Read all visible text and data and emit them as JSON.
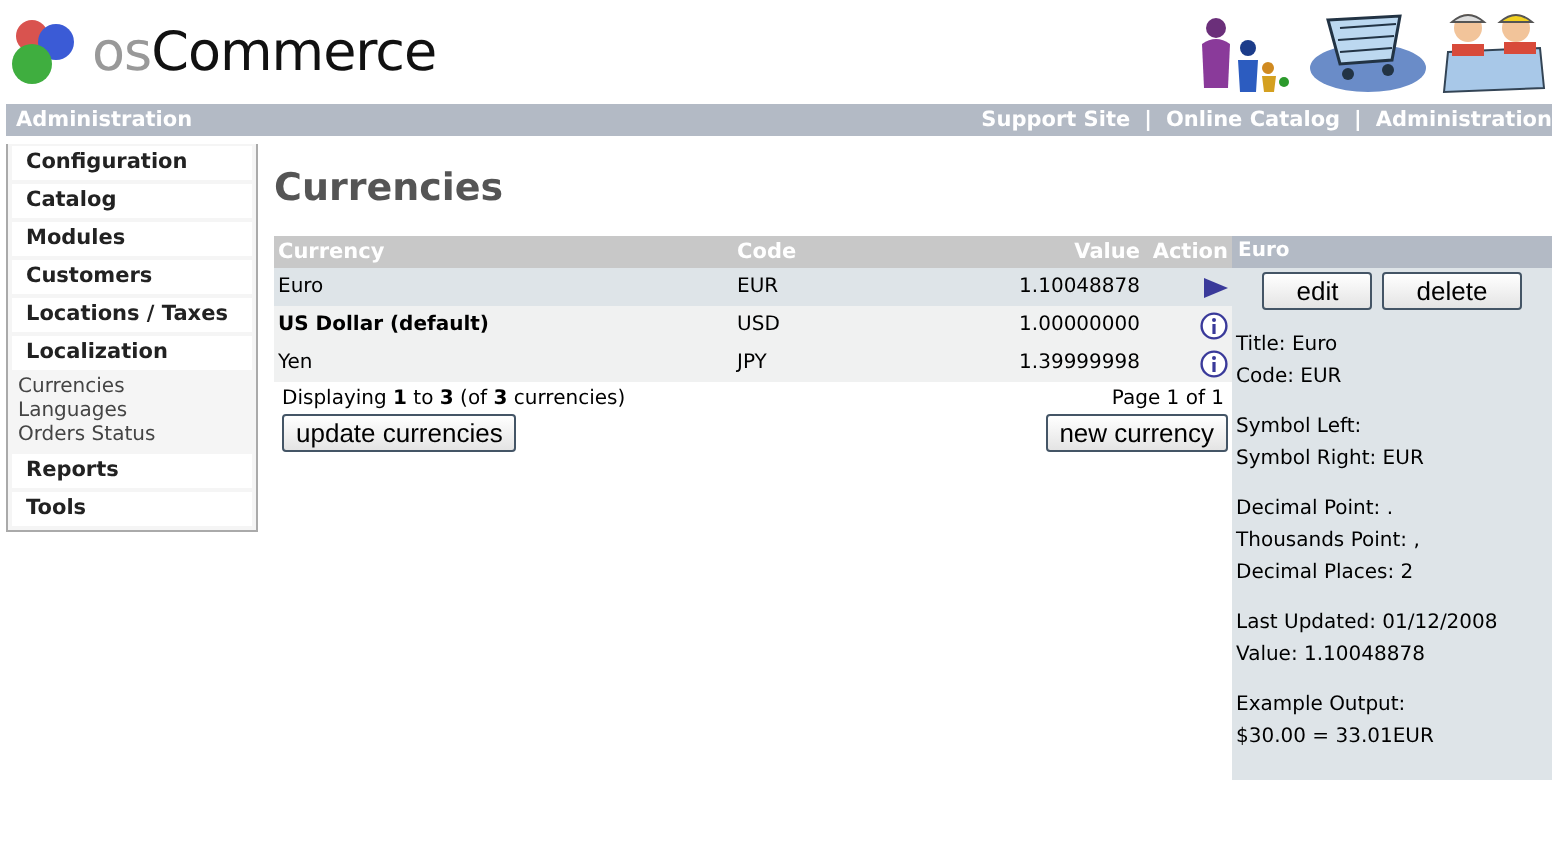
{
  "logo": {
    "prefix": "os",
    "name": "Commerce"
  },
  "top_bar": {
    "title": "Administration",
    "links": [
      "Support Site",
      "Online Catalog",
      "Administration"
    ],
    "separator": "|"
  },
  "sidebar": {
    "items": [
      {
        "label": "Configuration"
      },
      {
        "label": "Catalog"
      },
      {
        "label": "Modules"
      },
      {
        "label": "Customers"
      },
      {
        "label": "Locations / Taxes"
      },
      {
        "label": "Localization",
        "children": [
          {
            "label": "Currencies"
          },
          {
            "label": "Languages"
          },
          {
            "label": "Orders Status"
          }
        ]
      },
      {
        "label": "Reports"
      },
      {
        "label": "Tools"
      }
    ]
  },
  "page_title": "Currencies",
  "table": {
    "columns": [
      "Currency",
      "Code",
      "Value",
      "Action"
    ],
    "rows": [
      {
        "currency": "Euro",
        "code": "EUR",
        "value": "1.10048878",
        "selected": true,
        "default": false
      },
      {
        "currency": "US Dollar (default)",
        "code": "USD",
        "value": "1.00000000",
        "selected": false,
        "default": true
      },
      {
        "currency": "Yen",
        "code": "JPY",
        "value": "1.39999998",
        "selected": false,
        "default": false
      }
    ]
  },
  "paging": {
    "summary": "Displaying **1** to **3** (of **3** currencies)",
    "page": "Page 1 of 1"
  },
  "buttons": {
    "update": "update currencies",
    "new": "new currency"
  },
  "info_panel": {
    "title": "Euro",
    "buttons": [
      "edit",
      "delete"
    ],
    "groups": [
      [
        "Title: Euro",
        "Code: EUR"
      ],
      [
        "Symbol Left:",
        "Symbol Right: EUR"
      ],
      [
        "Decimal Point: .",
        "Thousands Point: ,",
        "Decimal Places: 2"
      ],
      [
        "Last Updated: 01/12/2008",
        "Value: 1.10048878"
      ],
      [
        "Example Output:",
        "$30.00 = 33.01EUR"
      ]
    ]
  }
}
